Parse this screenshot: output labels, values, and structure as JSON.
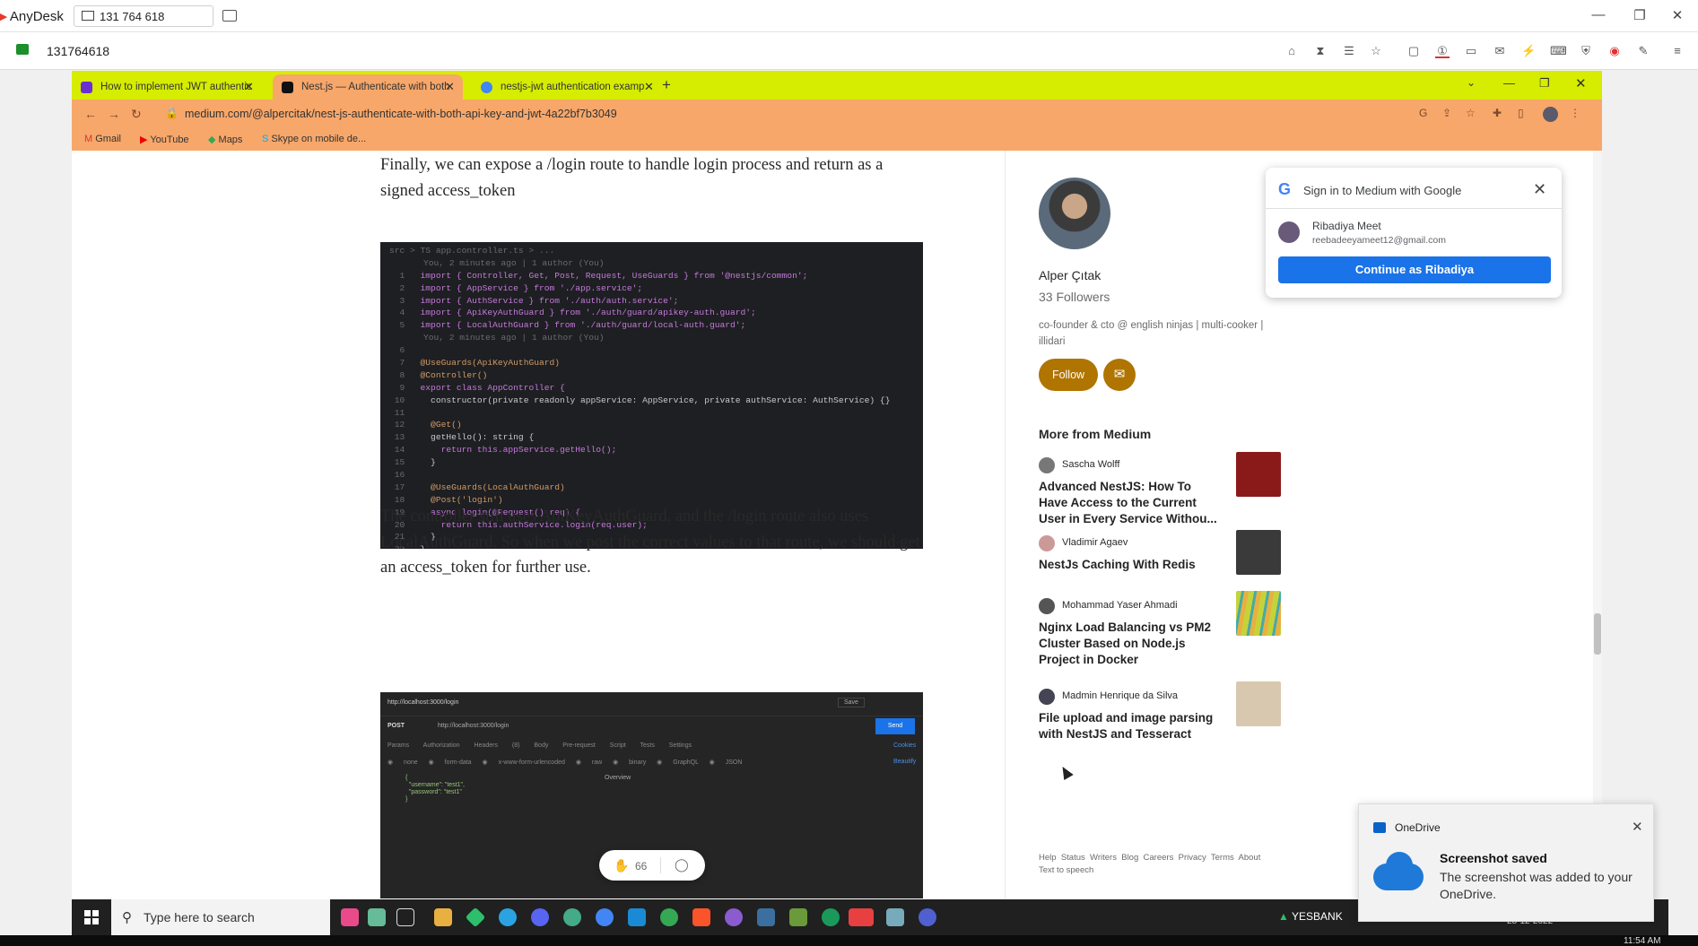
{
  "anydesk": {
    "app_name": "AnyDesk",
    "address_value": "131 764 618",
    "session_id": "131764618",
    "window_controls": [
      "—",
      "❐",
      "✕"
    ]
  },
  "browser": {
    "tabs": [
      {
        "label": "How to implement JWT authentic",
        "favicon_color": "#6b2fd1",
        "active": false
      },
      {
        "label": "Nest.js — Authenticate with both",
        "favicon_color": "#111111",
        "active": true
      },
      {
        "label": "nestjs-jwt authentication examp",
        "favicon_color": "#4285f4",
        "active": false
      }
    ],
    "new_tab": "+",
    "url": "medium.com/@alpercitak/nest-js-authenticate-with-both-api-key-and-jwt-4a22bf7b3049",
    "bookmarks": [
      "Gmail",
      "YouTube",
      "Maps",
      "Skype on mobile de..."
    ]
  },
  "article": {
    "para1": "Finally, we can expose a /login route to handle login process and return as a signed access_token",
    "para2": "The controller still uses ApiKeyAuthGuard, and the /login route also uses LocalAuthGuard. So when we post the correct values to that route, we should get an access_token for further use.",
    "code_breadcrumb": "src > TS app.controller.ts > ...",
    "code_meta1": "You, 2 minutes ago | 1 author (You)",
    "code_meta2": "You, 2 minutes ago | 1 author (You)",
    "code_lines": [
      "import { Controller, Get, Post, Request, UseGuards } from '@nestjs/common';",
      "import { AppService } from './app.service';",
      "import { AuthService } from './auth/auth.service';",
      "import { ApiKeyAuthGuard } from './auth/guard/apikey-auth.guard';",
      "import { LocalAuthGuard } from './auth/guard/local-auth.guard';",
      "",
      "@UseGuards(ApiKeyAuthGuard)",
      "@Controller()",
      "export class AppController {",
      "  constructor(private readonly appService: AppService, private authService: AuthService) {}",
      "",
      "  @Get()",
      "  getHello(): string {",
      "    return this.appService.getHello();",
      "  }",
      "",
      "  @UseGuards(LocalAuthGuard)",
      "  @Post('login')",
      "  async login(@Request() req) {",
      "    return this.authService.login(req.user);",
      "  }",
      "}"
    ],
    "postman_url": "http://localhost:3000/login",
    "postman_method": "POST",
    "postman_send": "Send",
    "postman_save": "Save",
    "postman_tabs": [
      "Params",
      "Authorization",
      "Headers (8)",
      "Body",
      "Pre-request Script",
      "Tests",
      "Settings"
    ],
    "postman_cookies": "Cookies",
    "postman_body_opts": [
      "none",
      "form-data",
      "x-www-form-urlencoded",
      "raw",
      "binary",
      "GraphQL",
      "JSON"
    ],
    "postman_beautify": "Beautify",
    "postman_overview": "Overview",
    "postman_body_lines": [
      "{",
      "  \"username\": \"test1\",",
      "  \"password\": \"test1\"",
      "}"
    ],
    "clap_count": "66"
  },
  "sidebar": {
    "author_name": "Alper Çıtak",
    "followers": "33 Followers",
    "bio": "co-founder & cto @ english ninjas | multi-cooker | illidari",
    "follow_label": "Follow",
    "more_title": "More from Medium",
    "stories": [
      {
        "author": "Sascha Wolff",
        "title": "Advanced NestJS: How To Have Access to the Current User in Every Service Withou...",
        "thumb_color": "#8a1a1a"
      },
      {
        "author": "Vladimir Agaev",
        "title": "NestJs Caching With Redis",
        "thumb_color": "#3a3a3a"
      },
      {
        "author": "Mohammad Yaser Ahmadi",
        "title": "Nginx Load Balancing vs PM2 Cluster Based on Node.js Project in Docker",
        "thumb_color": "#b8c23a"
      },
      {
        "author": "Madmin",
        "author_suffix": "Henrique da Silva",
        "title": "File upload and image parsing with NestJS and Tesseract",
        "thumb_color": "#d8c8b0"
      }
    ],
    "footer": [
      "Help",
      "Status",
      "Writers",
      "Blog",
      "Careers",
      "Privacy",
      "Terms",
      "About",
      "Text to speech"
    ]
  },
  "google_signin": {
    "title": "Sign in to Medium with Google",
    "account_name": "Ribadiya Meet",
    "account_email": "reebadeeyameet12@gmail.com",
    "continue_label": "Continue as Ribadiya"
  },
  "taskbar": {
    "search_placeholder": "Type here to search",
    "bank_label": "YESBANK",
    "date": "28-12-2022",
    "time": "11:54 AM"
  },
  "onedrive": {
    "app": "OneDrive",
    "title": "Screenshot saved",
    "body": "The screenshot was added to your OneDrive."
  },
  "colors": {
    "tab_strip": "#d6ec00",
    "toolbar": "#f7a76a",
    "follow": "#b07400",
    "google_button": "#1a73e8"
  }
}
